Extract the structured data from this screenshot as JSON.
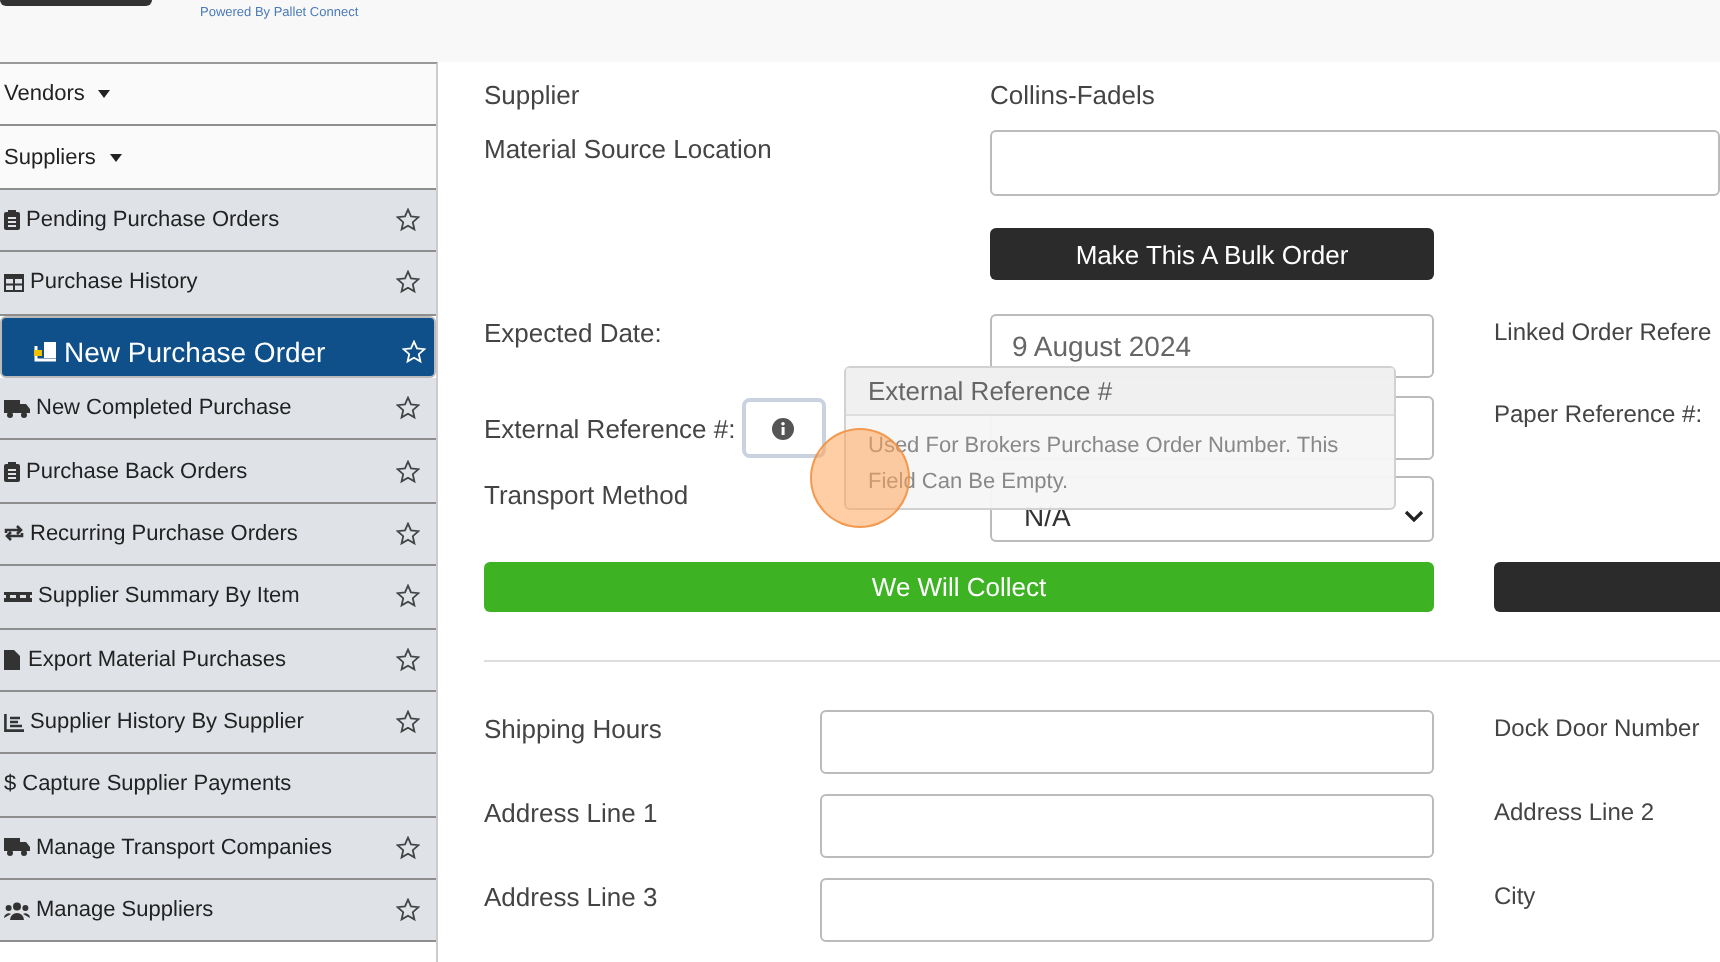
{
  "header": {
    "powered_by": "Powered By Pallet Connect"
  },
  "sidebar": {
    "items": [
      {
        "label": "Vendors",
        "kind": "dropdown",
        "selected": false
      },
      {
        "label": "Suppliers",
        "kind": "dropdown",
        "selected": false
      },
      {
        "label": "Pending Purchase Orders",
        "kind": "link",
        "star": true,
        "selected": false
      },
      {
        "label": "Purchase History",
        "kind": "link",
        "star": true,
        "selected": false
      },
      {
        "label": "New Purchase Order",
        "kind": "link",
        "star": true,
        "selected": true
      },
      {
        "label": "New Completed Purchase",
        "kind": "link",
        "star": true,
        "selected": false
      },
      {
        "label": "Purchase Back Orders",
        "kind": "link",
        "star": true,
        "selected": false
      },
      {
        "label": "Recurring Purchase Orders",
        "kind": "link",
        "star": true,
        "selected": false
      },
      {
        "label": "Supplier Summary By Item",
        "kind": "link",
        "star": true,
        "selected": false
      },
      {
        "label": "Export Material Purchases",
        "kind": "link",
        "star": true,
        "selected": false
      },
      {
        "label": "Supplier History By Supplier",
        "kind": "link",
        "star": true,
        "selected": false
      },
      {
        "label": "Capture Supplier Payments",
        "kind": "link",
        "glyph": "$",
        "star": false,
        "selected": false
      },
      {
        "label": "Manage Transport Companies",
        "kind": "link",
        "star": true,
        "selected": false
      },
      {
        "label": "Manage Suppliers",
        "kind": "link",
        "star": true,
        "selected": false
      }
    ]
  },
  "form": {
    "supplier_label": "Supplier",
    "supplier_value": "Collins-Fadels",
    "material_source_label": "Material Source Location",
    "bulk_button": "Make This A Bulk Order",
    "expected_date_label": "Expected Date:",
    "expected_date_value": "9 August 2024",
    "linked_order_label": "Linked Order Refere",
    "external_ref_label": "External Reference #:",
    "paper_ref_label": "Paper Reference #:",
    "transport_label": "Transport Method",
    "transport_value": "N/A",
    "collect_button": "We Will Collect"
  },
  "tooltip": {
    "title": "External Reference #",
    "body": "Used For Brokers Purchase Order Number. This Field Can Be Empty."
  },
  "address": {
    "rows": [
      {
        "label": "Shipping Hours",
        "right_label": "Dock Door Number"
      },
      {
        "label": "Address Line 1",
        "right_label": "Address Line 2"
      },
      {
        "label": "Address Line 3",
        "right_label": "City"
      }
    ]
  }
}
